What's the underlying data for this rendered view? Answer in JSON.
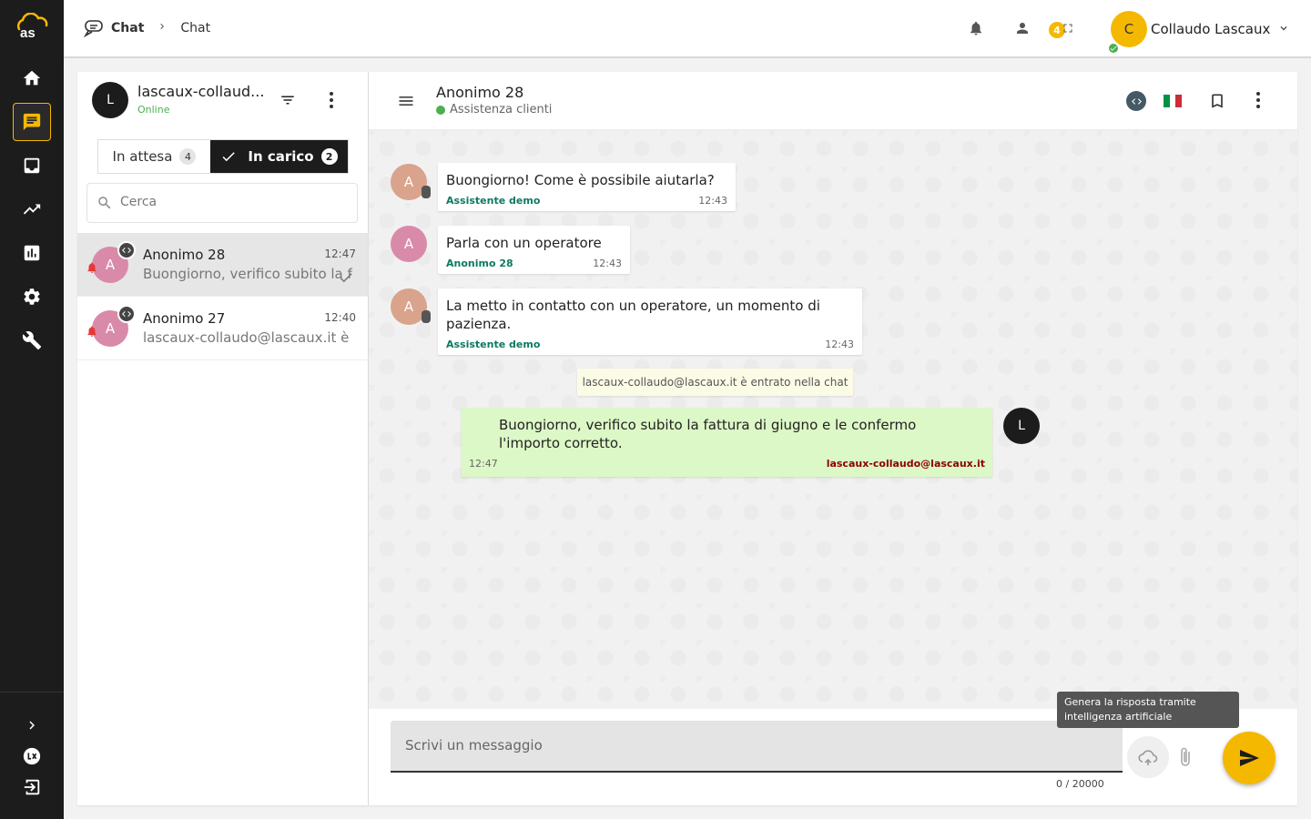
{
  "breadcrumb": {
    "section": "Chat",
    "page": "Chat"
  },
  "topbar": {
    "notifications_count": "4",
    "user_initial": "C",
    "user_name": "Collaudo Lascaux"
  },
  "agent": {
    "initial": "L",
    "name": "lascaux-collaud...",
    "status": "Online"
  },
  "tabs": {
    "waiting_label": "In attesa",
    "waiting_count": "4",
    "handled_label": "In carico",
    "handled_count": "2"
  },
  "search": {
    "placeholder": "Cerca"
  },
  "conversations": [
    {
      "initial": "A",
      "name": "Anonimo 28",
      "time": "12:47",
      "preview": "Buongiorno, verifico subito la f"
    },
    {
      "initial": "A",
      "name": "Anonimo 27",
      "time": "12:40",
      "preview": "lascaux-collaudo@lascaux.it è"
    }
  ],
  "chat": {
    "title": "Anonimo 28",
    "subtitle": "Assistenza clienti",
    "messages": [
      {
        "initial": "A",
        "text": "Buongiorno! Come è possibile aiutarla?",
        "author": "Assistente demo",
        "time": "12:43"
      },
      {
        "initial": "A",
        "text": "Parla con un operatore",
        "author": "Anonimo 28",
        "time": "12:43"
      },
      {
        "initial": "A",
        "text": "La metto in contatto con un operatore, un momento di pazienza.",
        "author": "Assistente demo",
        "time": "12:43"
      }
    ],
    "system_note": "lascaux-collaudo@lascaux.it è entrato nella chat",
    "outgoing": {
      "initial": "L",
      "text": "Buongiorno, verifico subito la fattura di giugno e le confermo l'importo corretto.",
      "time": "12:47",
      "author": "lascaux-collaudo@lascaux.it"
    }
  },
  "composer": {
    "placeholder": "Scrivi un messaggio",
    "counter": "0 / 20000",
    "tooltip": "Genera la risposta tramite intelligenza artificiale"
  },
  "colors": {
    "accent": "#f5b800",
    "rail": "#1c1c1c",
    "outgoing_bubble": "#dcf8c6",
    "online": "#4caf50"
  }
}
